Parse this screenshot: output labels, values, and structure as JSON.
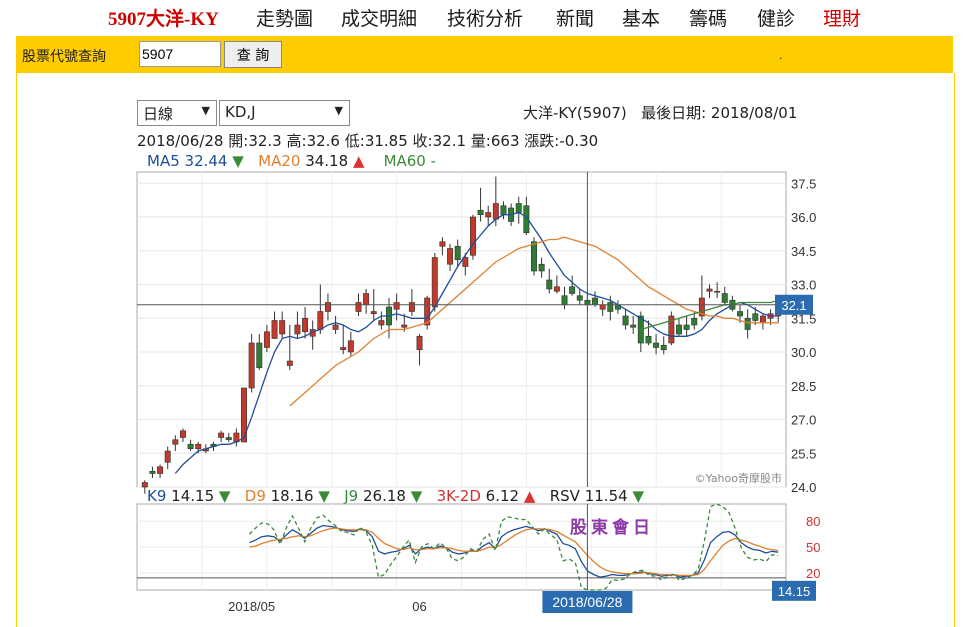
{
  "nav": {
    "brand": "5907大洋-KY",
    "items": [
      "走勢圖",
      "成交明細",
      "技術分析",
      "新聞",
      "基本",
      "籌碼",
      "健診",
      "理財"
    ]
  },
  "query": {
    "label": "股票代號查詢",
    "value": "5907",
    "button": "查 詢",
    "dot": "."
  },
  "controls": {
    "period": "日線",
    "indicator": "KD,J"
  },
  "header": {
    "stock": "大洋-KY(5907)",
    "last_date_label": "最後日期:",
    "last_date": "2018/08/01"
  },
  "ohlc": {
    "date": "2018/06/28",
    "open_label": "開:",
    "open": "32.3",
    "high_label": "高:",
    "high": "32.6",
    "low_label": "低:",
    "low": "31.85",
    "close_label": "收:",
    "close": "32.1",
    "vol_label": "量:",
    "volume": "663",
    "chg_label": "漲跌:",
    "change": "-0.30"
  },
  "ma": [
    {
      "name": "MA5",
      "value": "32.44",
      "arrow": "▼",
      "color": "#1f4e9a",
      "arrow_color": "#3a8a3a"
    },
    {
      "name": "MA20",
      "value": "34.18",
      "arrow": "▲",
      "color": "#e08030",
      "arrow_color": "#d33"
    },
    {
      "name": "MA60",
      "value": "-",
      "arrow": "",
      "color": "#3a8a3a",
      "arrow_color": "#3a8a3a"
    }
  ],
  "ind": [
    {
      "name": "K9",
      "value": "14.15",
      "arrow": "▼",
      "color": "#1f4e9a",
      "arrow_color": "#3a8a3a"
    },
    {
      "name": "D9",
      "value": "18.16",
      "arrow": "▼",
      "color": "#e08030",
      "arrow_color": "#3a8a3a"
    },
    {
      "name": "J9",
      "value": "26.18",
      "arrow": "▼",
      "color": "#3a8a3a",
      "arrow_color": "#3a8a3a"
    },
    {
      "name": "3K-2D",
      "value": "6.12",
      "arrow": "▲",
      "color": "#c33",
      "arrow_color": "#d33"
    },
    {
      "name": "RSV",
      "value": "11.54",
      "arrow": "▼",
      "color": "#222",
      "arrow_color": "#3a8a3a"
    }
  ],
  "watermark": "©Yahoo奇摩股市",
  "event_label": "股東會日",
  "cursor_date": "2018/06/28",
  "price_tag": "32.1",
  "k_tag": "14.15",
  "chart_data": {
    "type": "candlestick",
    "price_axis": {
      "ticks": [
        "37.5",
        "36.0",
        "34.5",
        "33.0",
        "31.5",
        "30.0",
        "28.5",
        "27.0",
        "25.5",
        "24.0"
      ],
      "range": [
        24.0,
        38.0
      ]
    },
    "kd_axis": {
      "ticks": [
        "80",
        "50",
        "20"
      ],
      "range": [
        0,
        100
      ]
    },
    "x_ticks": [
      "2018/05",
      "06"
    ],
    "candles": [
      [
        24.0,
        24.3,
        23.7,
        24.2
      ],
      [
        24.7,
        24.9,
        24.4,
        24.6
      ],
      [
        24.6,
        25.0,
        24.4,
        24.9
      ],
      [
        25.1,
        25.8,
        24.8,
        25.6
      ],
      [
        25.9,
        26.3,
        25.6,
        26.1
      ],
      [
        26.2,
        26.6,
        26.0,
        26.5
      ],
      [
        25.9,
        26.1,
        25.6,
        25.7
      ],
      [
        25.7,
        26.0,
        25.5,
        25.9
      ],
      [
        25.6,
        25.9,
        25.5,
        25.7
      ],
      [
        25.9,
        26.0,
        25.6,
        25.8
      ],
      [
        26.2,
        26.5,
        26.0,
        26.4
      ],
      [
        26.2,
        26.4,
        26.0,
        26.1
      ],
      [
        26.0,
        26.6,
        25.8,
        26.4
      ],
      [
        26.0,
        28.4,
        26.0,
        28.4
      ],
      [
        28.4,
        30.8,
        28.2,
        30.4
      ],
      [
        30.4,
        30.8,
        29.2,
        29.3
      ],
      [
        30.2,
        31.2,
        30.0,
        30.9
      ],
      [
        30.6,
        31.8,
        30.6,
        31.4
      ],
      [
        30.8,
        31.8,
        30.6,
        31.4
      ],
      [
        29.4,
        31.2,
        29.2,
        29.6
      ],
      [
        30.8,
        31.8,
        30.6,
        31.2
      ],
      [
        30.9,
        32.0,
        30.6,
        31.5
      ],
      [
        30.7,
        31.4,
        30.1,
        31.0
      ],
      [
        31.0,
        33.0,
        30.8,
        31.8
      ],
      [
        31.8,
        32.6,
        31.4,
        32.2
      ],
      [
        31.0,
        31.6,
        30.8,
        31.2
      ],
      [
        30.1,
        31.2,
        29.9,
        30.2
      ],
      [
        30.0,
        30.9,
        29.8,
        30.5
      ],
      [
        31.8,
        32.6,
        31.6,
        32.2
      ],
      [
        32.1,
        32.8,
        31.7,
        32.6
      ],
      [
        31.7,
        32.8,
        31.4,
        31.8
      ],
      [
        31.2,
        31.8,
        31.0,
        31.4
      ],
      [
        32.0,
        32.4,
        30.6,
        31.2
      ],
      [
        31.9,
        32.6,
        31.4,
        32.2
      ],
      [
        31.1,
        31.7,
        30.9,
        31.2
      ],
      [
        31.8,
        32.8,
        31.6,
        32.2
      ],
      [
        30.1,
        30.8,
        29.4,
        30.7
      ],
      [
        31.2,
        32.5,
        31.0,
        32.4
      ],
      [
        32.0,
        34.4,
        31.8,
        34.2
      ],
      [
        34.7,
        35.1,
        34.3,
        34.9
      ],
      [
        33.9,
        34.8,
        33.6,
        34.6
      ],
      [
        34.7,
        35.0,
        33.8,
        34.1
      ],
      [
        33.8,
        34.4,
        33.4,
        34.2
      ],
      [
        34.3,
        36.1,
        34.1,
        36.0
      ],
      [
        36.3,
        37.3,
        35.8,
        36.1
      ],
      [
        36.0,
        36.5,
        35.6,
        36.2
      ],
      [
        35.9,
        37.8,
        35.6,
        36.6
      ],
      [
        36.5,
        36.7,
        35.9,
        36.1
      ],
      [
        36.4,
        36.6,
        35.6,
        35.8
      ],
      [
        36.6,
        36.9,
        35.7,
        36.2
      ],
      [
        36.5,
        36.9,
        35.2,
        35.3
      ],
      [
        34.9,
        35.1,
        33.4,
        33.6
      ],
      [
        33.9,
        34.2,
        33.3,
        33.6
      ],
      [
        33.2,
        33.7,
        32.6,
        32.8
      ],
      [
        32.7,
        33.4,
        32.6,
        32.9
      ],
      [
        32.5,
        32.9,
        31.9,
        32.1
      ],
      [
        32.9,
        33.4,
        32.5,
        32.6
      ],
      [
        32.5,
        32.8,
        32.1,
        32.3
      ],
      [
        32.3,
        32.6,
        31.85,
        32.1
      ],
      [
        32.4,
        32.7,
        32.0,
        32.1
      ],
      [
        31.9,
        32.3,
        31.6,
        32.1
      ],
      [
        32.2,
        32.5,
        31.4,
        31.8
      ],
      [
        32.1,
        32.3,
        31.7,
        31.9
      ],
      [
        31.6,
        31.9,
        31.0,
        31.2
      ],
      [
        31.2,
        31.6,
        30.8,
        31.1
      ],
      [
        31.6,
        31.8,
        30.0,
        30.4
      ],
      [
        30.7,
        31.4,
        30.3,
        30.4
      ],
      [
        30.4,
        30.8,
        29.9,
        30.2
      ],
      [
        30.3,
        30.7,
        29.9,
        30.1
      ],
      [
        30.4,
        31.8,
        30.3,
        31.6
      ],
      [
        31.2,
        31.5,
        30.7,
        30.8
      ],
      [
        31.2,
        31.6,
        30.7,
        31.0
      ],
      [
        31.5,
        31.8,
        31.0,
        31.2
      ],
      [
        31.6,
        33.4,
        31.4,
        32.4
      ],
      [
        32.7,
        33.0,
        32.4,
        32.8
      ],
      [
        32.7,
        33.1,
        32.4,
        32.7
      ],
      [
        32.6,
        32.9,
        32.1,
        32.2
      ],
      [
        32.3,
        32.5,
        31.8,
        31.9
      ],
      [
        31.8,
        32.1,
        31.3,
        31.6
      ],
      [
        31.5,
        31.9,
        30.6,
        31.0
      ],
      [
        31.7,
        32.0,
        31.2,
        31.4
      ],
      [
        31.3,
        31.7,
        31.0,
        31.6
      ],
      [
        31.5,
        31.9,
        31.2,
        31.7
      ],
      [
        31.6,
        32.0,
        31.3,
        31.8
      ]
    ],
    "ma5": [
      null,
      null,
      null,
      null,
      24.6,
      25.0,
      25.3,
      25.6,
      25.7,
      25.8,
      25.9,
      25.9,
      26.0,
      26.2,
      27.1,
      28.1,
      29.1,
      30.0,
      30.6,
      30.7,
      30.6,
      30.7,
      30.9,
      31.0,
      31.2,
      31.3,
      31.2,
      31.0,
      30.9,
      31.1,
      31.4,
      31.6,
      31.6,
      31.7,
      31.6,
      31.5,
      31.5,
      31.5,
      32.0,
      32.6,
      33.2,
      33.8,
      34.3,
      34.8,
      35.2,
      35.6,
      35.9,
      36.1,
      36.1,
      36.2,
      36.0,
      35.5,
      35.0,
      34.4,
      33.9,
      33.4,
      33.1,
      32.8,
      32.6,
      32.5,
      32.4,
      32.3,
      32.1,
      31.9,
      31.7,
      31.5,
      31.3,
      31.0,
      30.8,
      30.7,
      30.7,
      30.7,
      30.8,
      31.0,
      31.4,
      31.7,
      31.9,
      32.1,
      32.2,
      32.1,
      31.9,
      31.7,
      31.6,
      31.6
    ],
    "ma20": [
      null,
      null,
      null,
      null,
      null,
      null,
      null,
      null,
      null,
      null,
      null,
      null,
      null,
      null,
      null,
      null,
      null,
      null,
      null,
      27.6,
      27.9,
      28.2,
      28.5,
      28.8,
      29.1,
      29.4,
      29.6,
      29.8,
      30.0,
      30.3,
      30.6,
      30.8,
      31.0,
      31.0,
      31.0,
      31.1,
      31.2,
      31.3,
      31.6,
      31.9,
      32.2,
      32.5,
      32.8,
      33.1,
      33.4,
      33.7,
      34.0,
      34.2,
      34.4,
      34.6,
      34.7,
      34.8,
      34.9,
      35.0,
      35.0,
      35.1,
      35.0,
      34.9,
      34.8,
      34.7,
      34.5,
      34.3,
      34.1,
      33.8,
      33.5,
      33.2,
      32.9,
      32.7,
      32.5,
      32.3,
      32.1,
      31.9,
      31.8,
      31.7,
      31.6,
      31.6,
      31.5,
      31.5,
      31.4,
      31.3,
      31.3,
      31.3,
      31.3,
      31.3
    ],
    "ma60": [
      null,
      null,
      null,
      null,
      null,
      null,
      null,
      null,
      null,
      null,
      null,
      null,
      null,
      null,
      null,
      null,
      null,
      null,
      null,
      null,
      null,
      null,
      null,
      null,
      null,
      null,
      null,
      null,
      null,
      null,
      null,
      null,
      null,
      null,
      null,
      null,
      null,
      null,
      null,
      null,
      null,
      null,
      null,
      null,
      null,
      null,
      null,
      null,
      null,
      null,
      null,
      null,
      null,
      null,
      null,
      null,
      null,
      null,
      null,
      null,
      null,
      null,
      null,
      null,
      null,
      31.0,
      31.1,
      31.2,
      31.3,
      31.4,
      31.5,
      31.6,
      31.7,
      31.8,
      31.9,
      32.0,
      32.1,
      32.1,
      32.2,
      32.2,
      32.2,
      32.2,
      32.2,
      32.3
    ],
    "k": [
      null,
      null,
      null,
      null,
      null,
      null,
      null,
      null,
      null,
      null,
      null,
      null,
      null,
      null,
      null,
      null,
      null,
      55,
      58,
      62,
      63,
      62,
      57,
      64,
      70,
      66,
      60,
      66,
      72,
      75,
      74,
      73,
      70,
      69,
      68,
      71,
      69,
      62,
      45,
      42,
      44,
      45,
      48,
      52,
      42,
      48,
      50,
      48,
      51,
      49,
      44,
      42,
      43,
      46,
      45,
      51,
      55,
      48,
      62,
      67,
      70,
      72,
      74,
      72,
      69,
      71,
      68,
      65,
      54,
      52,
      48,
      33,
      22,
      18,
      15,
      16,
      18,
      17,
      17,
      19,
      20,
      21,
      19,
      18,
      16,
      17,
      18,
      15,
      16,
      17,
      20,
      35,
      55,
      62,
      67,
      68,
      64,
      55,
      50,
      47,
      46,
      43,
      45,
      44
    ],
    "d": [
      null,
      null,
      null,
      null,
      null,
      null,
      null,
      null,
      null,
      null,
      null,
      null,
      null,
      null,
      null,
      null,
      null,
      50,
      51,
      54,
      56,
      58,
      59,
      60,
      62,
      63,
      62,
      63,
      66,
      69,
      71,
      72,
      71,
      70,
      70,
      70,
      70,
      67,
      60,
      54,
      51,
      48,
      47,
      49,
      47,
      47,
      48,
      48,
      49,
      49,
      48,
      46,
      45,
      45,
      45,
      47,
      50,
      49,
      53,
      58,
      63,
      67,
      70,
      71,
      71,
      71,
      70,
      68,
      64,
      60,
      56,
      48,
      40,
      33,
      27,
      23,
      21,
      20,
      19,
      19,
      19,
      20,
      20,
      19,
      18,
      18,
      18,
      17,
      17,
      17,
      18,
      24,
      34,
      43,
      52,
      57,
      60,
      58,
      56,
      53,
      51,
      48,
      47,
      46
    ],
    "j": [
      null,
      null,
      null,
      null,
      null,
      null,
      null,
      null,
      null,
      null,
      null,
      null,
      null,
      null,
      null,
      null,
      null,
      65,
      72,
      78,
      77,
      70,
      53,
      72,
      86,
      72,
      56,
      72,
      84,
      87,
      80,
      75,
      68,
      67,
      64,
      73,
      67,
      52,
      15,
      18,
      30,
      39,
      50,
      58,
      32,
      50,
      54,
      48,
      55,
      49,
      36,
      34,
      39,
      48,
      45,
      59,
      65,
      46,
      80,
      85,
      84,
      82,
      82,
      74,
      65,
      71,
      64,
      59,
      34,
      36,
      32,
      3,
      -14,
      -12,
      -9,
      2,
      12,
      11,
      13,
      19,
      22,
      23,
      17,
      16,
      12,
      15,
      18,
      11,
      14,
      17,
      24,
      57,
      97,
      100,
      97,
      90,
      72,
      49,
      38,
      35,
      36,
      33,
      41,
      40
    ]
  }
}
